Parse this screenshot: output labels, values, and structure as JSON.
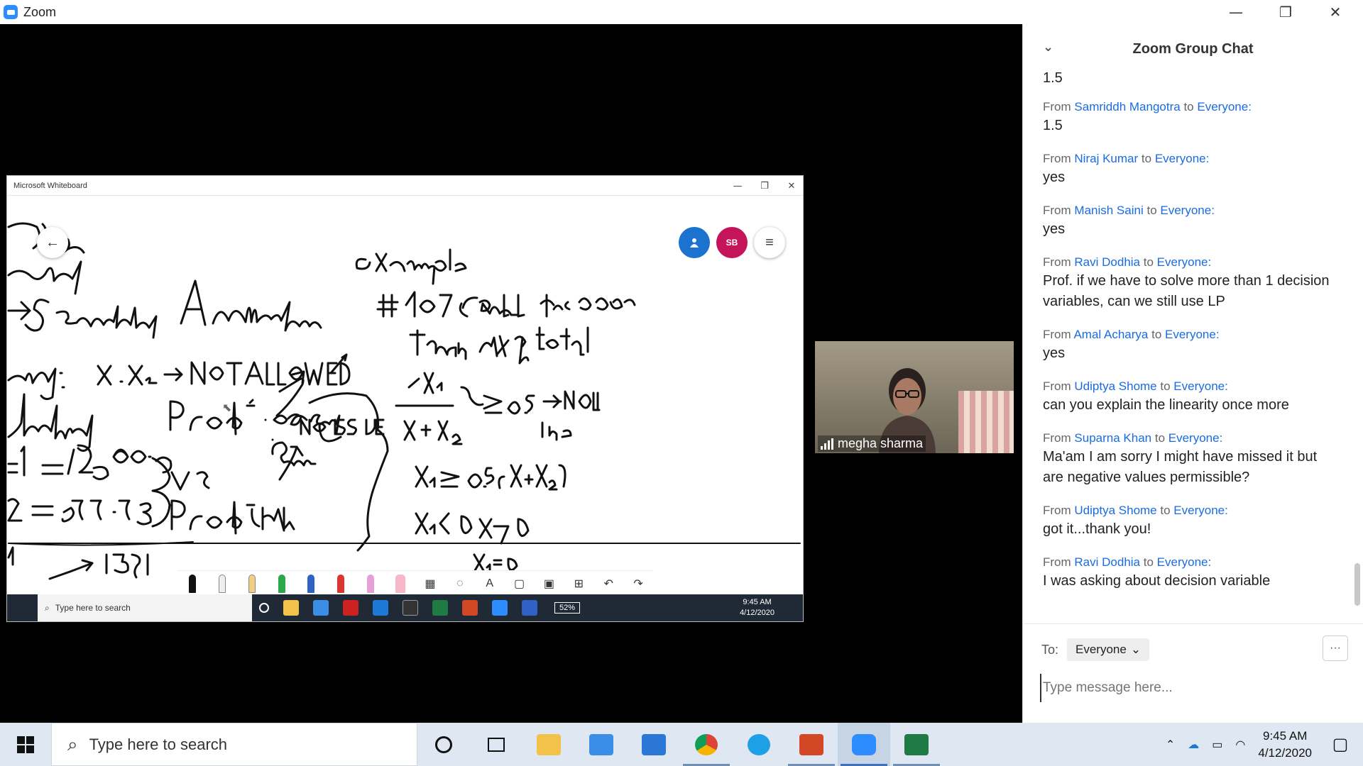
{
  "window": {
    "title": "Zoom",
    "minimize": "—",
    "restore": "❐",
    "close": "✕"
  },
  "whiteboard": {
    "title": "Microsoft Whiteboard",
    "back_icon": "←",
    "avatar_initials": "SB",
    "menu_icon": "≡",
    "taskbar_search": "Type here to search",
    "battery": "52%",
    "time": "9:45 AM",
    "date": "4/12/2020"
  },
  "participant": {
    "name": "megha sharma"
  },
  "chat": {
    "title": "Zoom Group Chat",
    "collapse_icon": "⌄",
    "first_text": "1.5",
    "messages": [
      {
        "from_label": "From",
        "sender": "Samriddh Mangotra",
        "to_label": "to",
        "recipient": "Everyone:",
        "text": "1.5"
      },
      {
        "from_label": "From",
        "sender": "Niraj Kumar",
        "to_label": "to",
        "recipient": "Everyone:",
        "text": "yes"
      },
      {
        "from_label": "From",
        "sender": "Manish Saini",
        "to_label": "to",
        "recipient": "Everyone:",
        "text": "yes"
      },
      {
        "from_label": "From",
        "sender": "Ravi Dodhia",
        "to_label": "to",
        "recipient": "Everyone:",
        "text": "Prof. if we have to solve more than 1 decision variables, can we still use LP"
      },
      {
        "from_label": "From",
        "sender": "Amal Acharya",
        "to_label": "to",
        "recipient": "Everyone:",
        "text": "yes"
      },
      {
        "from_label": "From",
        "sender": "Udiptya Shome",
        "to_label": "to",
        "recipient": "Everyone:",
        "text": "can you explain the linearity once more"
      },
      {
        "from_label": "From",
        "sender": "Suparna Khan",
        "to_label": "to",
        "recipient": "Everyone:",
        "text": "Ma'am I am sorry I might have missed it but are negative values permissible?"
      },
      {
        "from_label": "From",
        "sender": "Udiptya Shome",
        "to_label": "to",
        "recipient": "Everyone:",
        "text": "got it...thank you!"
      },
      {
        "from_label": "From",
        "sender": "Ravi Dodhia",
        "to_label": "to",
        "recipient": "Everyone:",
        "text": "I was asking about decision variable"
      }
    ],
    "to_label": "To:",
    "to_value": "Everyone",
    "more_icon": "···",
    "input_placeholder": "Type message here..."
  },
  "taskbar": {
    "search_placeholder": "Type here to search",
    "time": "9:45 AM",
    "date": "4/12/2020"
  }
}
